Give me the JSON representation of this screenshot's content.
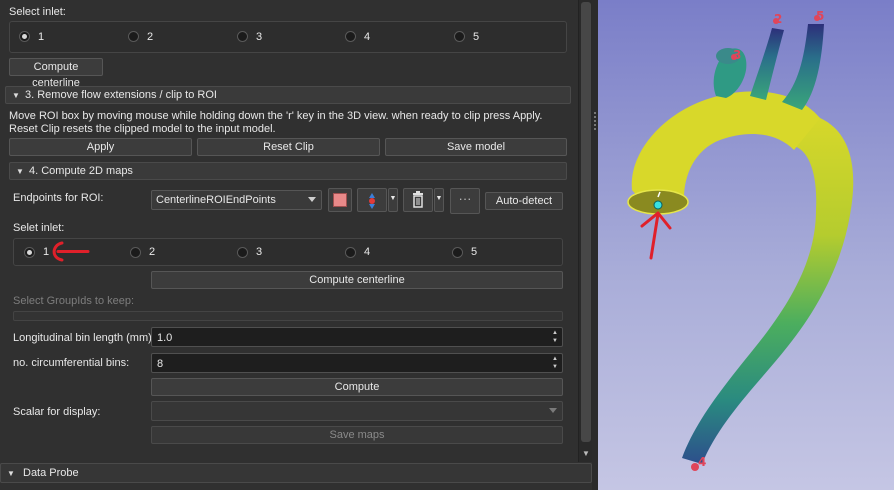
{
  "panel": {
    "select_inlet_label": "Select inlet:",
    "inlet_options": [
      "1",
      "2",
      "3",
      "4",
      "5"
    ],
    "compute_centerline_label": "Compute centerline",
    "section3": {
      "title": "3. Remove flow extensions / clip to ROI",
      "description": "Move ROI box by moving mouse while holding down the 'r' key in the 3D view. when ready to clip press Apply. Reset Clip resets the clipped model to the input model.",
      "apply_label": "Apply",
      "reset_clip_label": "Reset Clip",
      "save_model_label": "Save model"
    },
    "section4": {
      "title": "4. Compute 2D maps",
      "endpoints_label": "Endpoints for ROI:",
      "endpoints_value": "CenterlineROIEndPoints",
      "auto_detect_label": "Auto-detect",
      "selet_inlet_label": "Selet inlet:",
      "inlet_options": [
        "1",
        "2",
        "3",
        "4",
        "5"
      ],
      "compute_centerline_label": "Compute centerline",
      "group_ids_label": "Select GroupIds to keep:",
      "bin_length_label": "Longitudinal bin length (mm):",
      "bin_length_value": "1.0",
      "circ_bins_label": "no. circumferential bins:",
      "circ_bins_value": "8",
      "compute_label": "Compute",
      "scalar_label": "Scalar for display:",
      "scalar_value": "",
      "save_maps_label": "Save maps"
    },
    "data_probe_label": "Data Probe"
  },
  "viewer": {
    "markers": [
      "2",
      "5",
      "3",
      "4"
    ],
    "background_top": "#7a7ec8",
    "background_bottom": "#c5c6e4",
    "annotation_color": "#e0202a"
  },
  "colors": {
    "marker_fill": "#e0455a",
    "model_yellow": "#d6d62a",
    "model_green": "#2aa27a",
    "model_blue": "#2e4f8e"
  }
}
